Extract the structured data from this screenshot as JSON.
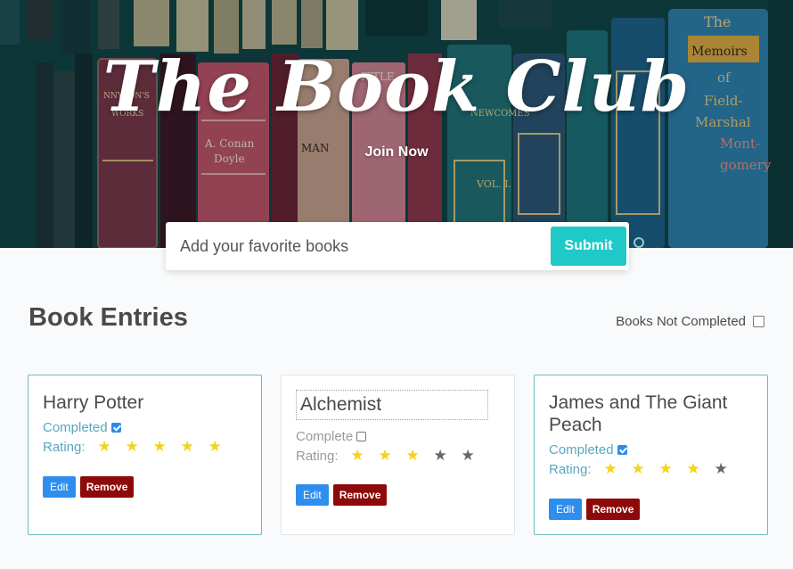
{
  "hero": {
    "title": "The Book Club",
    "join_label": "Join Now",
    "spines": [
      "NNYSON'S",
      "WORKS",
      "A. Conan",
      "Doyle",
      "ITTLE",
      "MAN",
      "NEWCOMES",
      "VOL. I.",
      "The",
      "Memoirs",
      "of",
      "Field-",
      "Marshal",
      "Mont-",
      "gomery"
    ]
  },
  "add_form": {
    "placeholder": "Add your favorite books",
    "submit_label": "Submit"
  },
  "section": {
    "title": "Book Entries",
    "filter_label": "Books Not Completed",
    "filter_checked": false
  },
  "books": [
    {
      "title": "Harry Potter",
      "status_label": "Completed",
      "completed": true,
      "rating_label": "Rating:",
      "rating": 5,
      "editing": false,
      "edit_label": "Edit",
      "remove_label": "Remove"
    },
    {
      "title": "Alchemist",
      "status_label": "Complete",
      "completed": false,
      "rating_label": "Rating:",
      "rating": 3,
      "editing": true,
      "edit_label": "Edit",
      "remove_label": "Remove"
    },
    {
      "title": "James and The Giant Peach",
      "status_label": "Completed",
      "completed": true,
      "rating_label": "Rating:",
      "rating": 4,
      "editing": false,
      "edit_label": "Edit",
      "remove_label": "Remove"
    }
  ],
  "colors": {
    "accent": "#1fc9c7",
    "edit_button": "#2e8eee",
    "remove_button": "#8e0a0a",
    "star_on": "#f4d31b",
    "star_off": "#666666",
    "completed_text": "#58a7c0"
  }
}
